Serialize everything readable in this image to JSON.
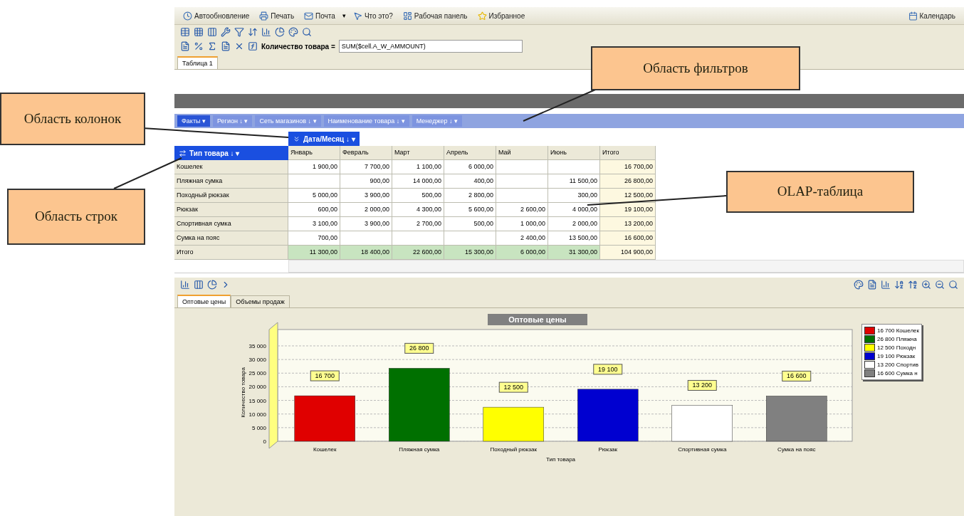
{
  "toolbar": {
    "buttons": [
      {
        "label": "Автообновление",
        "kind": "clock"
      },
      {
        "label": "Печать",
        "kind": "print"
      },
      {
        "label": "Почта",
        "kind": "mail",
        "menu_mark": "▾"
      },
      {
        "label": "Что это?",
        "kind": "help"
      },
      {
        "label": "Рабочая панель",
        "kind": "panel"
      },
      {
        "label": "Избранное",
        "kind": "star"
      }
    ],
    "right_buttons": [
      {
        "label": "Календарь",
        "kind": "calendar"
      }
    ]
  },
  "formula_bar": {
    "label": "Количество товара =",
    "value": "SUM($cell.A_W_AMMOUNT)"
  },
  "sheet_tabs": [
    {
      "label": "Таблица 1",
      "selected": true
    }
  ],
  "filter_area": {
    "fields": [
      {
        "label": "Факты",
        "kind": "facts",
        "menu_mark": "▾"
      },
      {
        "label": "Регион",
        "kind": "dimension",
        "sort_mark": "↓",
        "menu_mark": "▾"
      },
      {
        "label": "Сеть магазинов",
        "kind": "dimension",
        "sort_mark": "↓",
        "menu_mark": "▾"
      },
      {
        "label": "Наименование товара",
        "kind": "dimension",
        "sort_mark": "↓",
        "menu_mark": "▾"
      },
      {
        "label": "Менеджер",
        "kind": "dimension",
        "sort_mark": "↓",
        "menu_mark": "▾"
      }
    ]
  },
  "column_field": {
    "label": "Дата/Месяц",
    "sort_mark": "↓",
    "menu_mark": "▾"
  },
  "row_field": {
    "label": "Тип товара",
    "sort_mark": "↓",
    "menu_mark": "▾"
  },
  "table": {
    "columns": [
      "Январь",
      "Февраль",
      "Март",
      "Апрель",
      "Май",
      "Июнь",
      "Итого"
    ],
    "rows": [
      {
        "label": "Кошелек",
        "kind": "data",
        "cells": [
          "1 900,00",
          "7 700,00",
          "1 100,00",
          "6 000,00",
          "",
          "",
          "16 700,00"
        ]
      },
      {
        "label": "Пляжная сумка",
        "kind": "data",
        "cells": [
          "",
          "900,00",
          "14 000,00",
          "400,00",
          "",
          "11 500,00",
          "26 800,00"
        ]
      },
      {
        "label": "Походный рюкзак",
        "kind": "data",
        "cells": [
          "5 000,00",
          "3 900,00",
          "500,00",
          "2 800,00",
          "",
          "300,00",
          "12 500,00"
        ]
      },
      {
        "label": "Рюкзак",
        "kind": "data",
        "cells": [
          "600,00",
          "2 000,00",
          "4 300,00",
          "5 600,00",
          "2 600,00",
          "4 000,00",
          "19 100,00"
        ]
      },
      {
        "label": "Спортивная сумка",
        "kind": "data",
        "cells": [
          "3 100,00",
          "3 900,00",
          "2 700,00",
          "500,00",
          "1 000,00",
          "2 000,00",
          "13 200,00"
        ]
      },
      {
        "label": "Сумка на пояс",
        "kind": "data",
        "cells": [
          "700,00",
          "",
          "",
          "",
          "2 400,00",
          "13 500,00",
          "16 600,00"
        ]
      },
      {
        "label": "Итого",
        "kind": "total",
        "cells": [
          "11 300,00",
          "18 400,00",
          "22 600,00",
          "15 300,00",
          "6 000,00",
          "31 300,00",
          "104 900,00"
        ]
      }
    ]
  },
  "chart_tabs": [
    {
      "label": "Оптовые цены",
      "selected": true
    },
    {
      "label": "Объемы продаж",
      "selected": false
    }
  ],
  "chart": {
    "chart_data": {
      "type": "bar",
      "title": "Оптовые цены",
      "xlabel": "Тип товара",
      "ylabel": "Количество товара",
      "categories": [
        "Кошелек",
        "Пляжная сумка",
        "Походный рюкзак",
        "Рюкзак",
        "Спортивная сумка",
        "Сумка на пояс"
      ],
      "values": [
        16700,
        26800,
        12500,
        19100,
        13200,
        16600
      ],
      "ylim": [
        0,
        41000
      ],
      "grid": true,
      "yticks": [
        {
          "value": 0,
          "label": "0"
        },
        {
          "value": 5000,
          "label": "5 000"
        },
        {
          "value": 10000,
          "label": "10 000"
        },
        {
          "value": 15000,
          "label": "15 000"
        },
        {
          "value": 20000,
          "label": "20 000"
        },
        {
          "value": 25000,
          "label": "25 000"
        },
        {
          "value": 30000,
          "label": "30 000"
        },
        {
          "value": 35000,
          "label": "35 000"
        }
      ],
      "value_labels": [
        "16 700",
        "26 800",
        "12 500",
        "19 100",
        "13 200",
        "16 600"
      ]
    },
    "legend": [
      {
        "label": "16 700 Кошелек",
        "color": "#e00000"
      },
      {
        "label": "26 800 Пляжна",
        "color": "#007000"
      },
      {
        "label": "12 500 Походн",
        "color": "#ffff00"
      },
      {
        "label": "19 100 Рюкзак",
        "color": "#0000d0"
      },
      {
        "label": "13 200 Спортив",
        "color": "#ffffff"
      },
      {
        "label": "16 600 Сумка н",
        "color": "#808080"
      }
    ]
  },
  "callouts": [
    {
      "text": "Область колонок"
    },
    {
      "text": "Область строк"
    },
    {
      "text": "Область фильтров"
    },
    {
      "text": "OLAP-таблица"
    }
  ]
}
